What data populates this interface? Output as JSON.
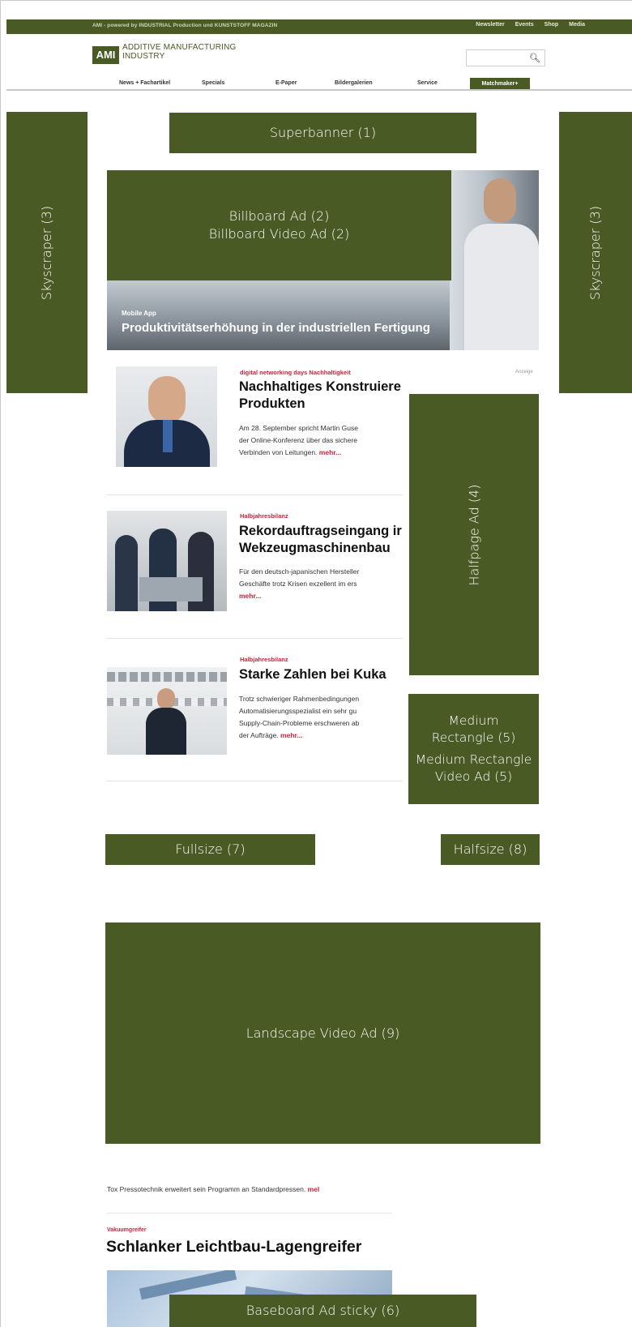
{
  "topbar": {
    "tagline": "AMI - powered by INDUSTRIAL Production und KUNSTSTOFF MAGAZIN",
    "links": [
      "Newsletter",
      "Events",
      "Shop",
      "Media"
    ]
  },
  "header": {
    "logo_badge": "AMI",
    "logo_text_line1": "ADDITIVE MANUFACTURING",
    "logo_text_line2": "INDUSTRY",
    "search": {
      "value": "",
      "icon": "search-icon"
    }
  },
  "nav": {
    "items": [
      "News + Fachartikel",
      "Specials",
      "E-Paper",
      "Bildergalerien",
      "Service"
    ],
    "cta": "Matchmaker+"
  },
  "ads": {
    "superbanner": "Superbanner (1)",
    "billboard_line1": "Billboard Ad (2)",
    "billboard_line2": "Billboard Video Ad (2)",
    "skyscraper_left": "Skyscraper (3)",
    "skyscraper_right": "Skyscraper (3)",
    "halfpage": "Halfpage Ad (4)",
    "medium_rect_line1": "Medium",
    "medium_rect_line2": "Rectangle (5)",
    "medium_rect_video_line1": "Medium Rectangle",
    "medium_rect_video_line2": "Video Ad (5)",
    "fullsize": "Fullsize (7)",
    "halfsize": "Halfsize (8)",
    "landscape": "Landscape Video Ad (9)",
    "baseboard": "Baseboard Ad sticky (6)",
    "color": "#4a5a24"
  },
  "hero": {
    "kicker": "Mobile App",
    "title": "Produktivitätserhöhung in der industriellen Fertigung"
  },
  "anzeige": "Anzeige",
  "articles": [
    {
      "category": "digital networking days Nachhaltigkeit",
      "title_line1": "Nachhaltiges Konstruiere",
      "title_line2": "Produkten",
      "teaser_lines": [
        "Am 28. September spricht Martin Guse",
        "der Online-Konferenz über das sichere",
        "Verbinden von Leitungen."
      ],
      "more": "mehr..."
    },
    {
      "category": "Halbjahresbilanz",
      "title_line1": "Rekordauftragseingang ir",
      "title_line2": "Wekzeugmaschinenbau",
      "teaser_lines": [
        "Für den deutsch-japanischen Hersteller",
        "Geschäfte trotz Krisen exzellent im ers"
      ],
      "more": "mehr..."
    },
    {
      "category": "Halbjahresbilanz",
      "title_line1": "Starke Zahlen bei Kuka",
      "teaser_lines": [
        "Trotz schwieriger Rahmenbedingungen",
        "Automatisierungsspezialist ein sehr gu",
        "Supply-Chain-Probleme erschweren ab",
        "der Aufträge."
      ],
      "more": "mehr..."
    }
  ],
  "lower": {
    "tox_text": "Tox Pressotechnik erweitert sein Programm an Standardpressen.",
    "tox_more": "mel",
    "category": "Vakuumgreifer",
    "title": "Schlanker Leichtbau-Lagengreifer"
  }
}
